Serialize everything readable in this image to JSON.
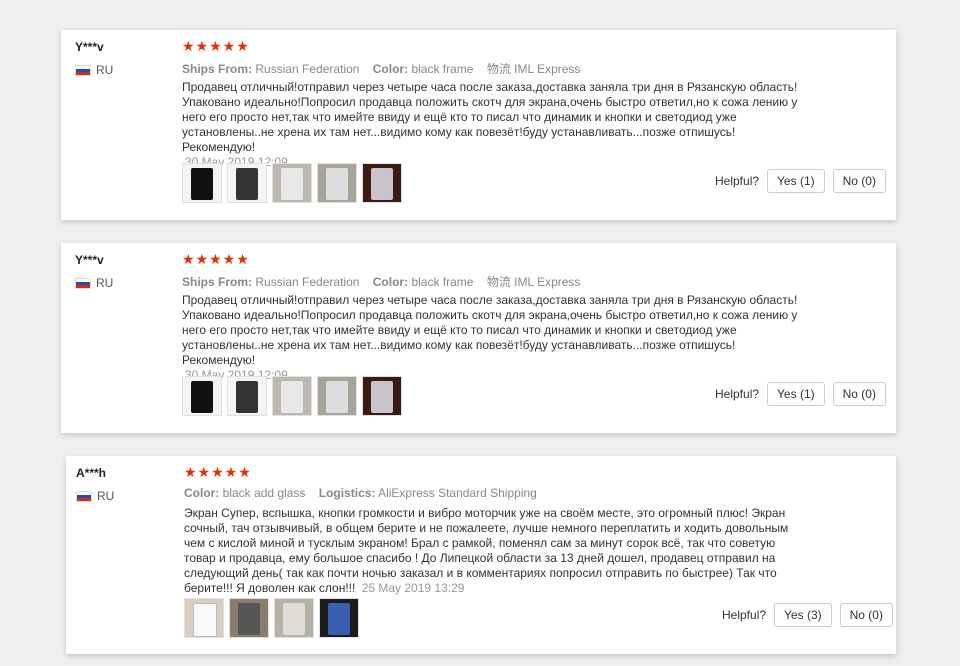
{
  "reviews": [
    {
      "user": "Y***v",
      "country": "RU",
      "stars": "★★★★★",
      "meta": [
        {
          "label": "Ships From:",
          "value": "Russian Federation"
        },
        {
          "label": "Color:",
          "value": "black frame"
        },
        {
          "label": "物流",
          "value": "IML Express"
        }
      ],
      "text": "Продавец отличный!отправил через четыре часа после заказа,доставка заняла три дня в Рязанскую область! Упаковано идеально!Попросил продавца положить скотч для экрана,очень быстро ответил,но к сожа лению у него его просто нет,так что имейте ввиду и ещё кто то писал что динамик и кнопки и светодиод уже установлены..не хрена их там нет...видимо кому как повезёт!буду устанавливать...позже отпишусь!Рекомендую!",
      "date": "30 May 2019 12:09",
      "helpful_label": "Helpful?",
      "yes_label": "Yes (1)",
      "no_label": "No (0)"
    },
    {
      "user": "Y***v",
      "country": "RU",
      "stars": "★★★★★",
      "meta": [
        {
          "label": "Ships From:",
          "value": "Russian Federation"
        },
        {
          "label": "Color:",
          "value": "black frame"
        },
        {
          "label": "物流",
          "value": "IML Express"
        }
      ],
      "text": "Продавец отличный!отправил через четыре часа после заказа,доставка заняла три дня в Рязанскую область! Упаковано идеально!Попросил продавца положить скотч для экрана,очень быстро ответил,но к сожа лению у него его просто нет,так что имейте ввиду и ещё кто то писал что динамик и кнопки и светодиод уже установлены..не хрена их там нет...видимо кому как повезёт!буду устанавливать...позже отпишусь!Рекомендую!",
      "date": "30 May 2019 12:09",
      "helpful_label": "Helpful?",
      "yes_label": "Yes (1)",
      "no_label": "No (0)"
    },
    {
      "user": "A***h",
      "country": "RU",
      "stars": "★★★★★",
      "meta": [
        {
          "label": "Color:",
          "value": "black add glass"
        },
        {
          "label": "Logistics:",
          "value": "AliExpress Standard Shipping"
        }
      ],
      "text": "Экран Супер, вспышка, кнопки громкости и вибро моторчик уже на своём месте, это огромный плюс! Экран сочный, тач отзывчивый, в общем берите и не пожалеете, лучше немного переплатить и ходить довольным чем с кислой миной и тусклым экраном! Брал с рамкой, поменял сам за минут сорок всё, так что советую товар и продавца, ему большое спасибо ! До Липецкой области за 13 дней дошел, продавец отправил на следующий день( так как почти ночью заказал и в комментариях попросил отправить по быстрее) Так что берите!!! Я доволен как слон!!!",
      "date": "25 May 2019 13:29",
      "helpful_label": "Helpful?",
      "yes_label": "Yes (3)",
      "no_label": "No (0)"
    }
  ]
}
